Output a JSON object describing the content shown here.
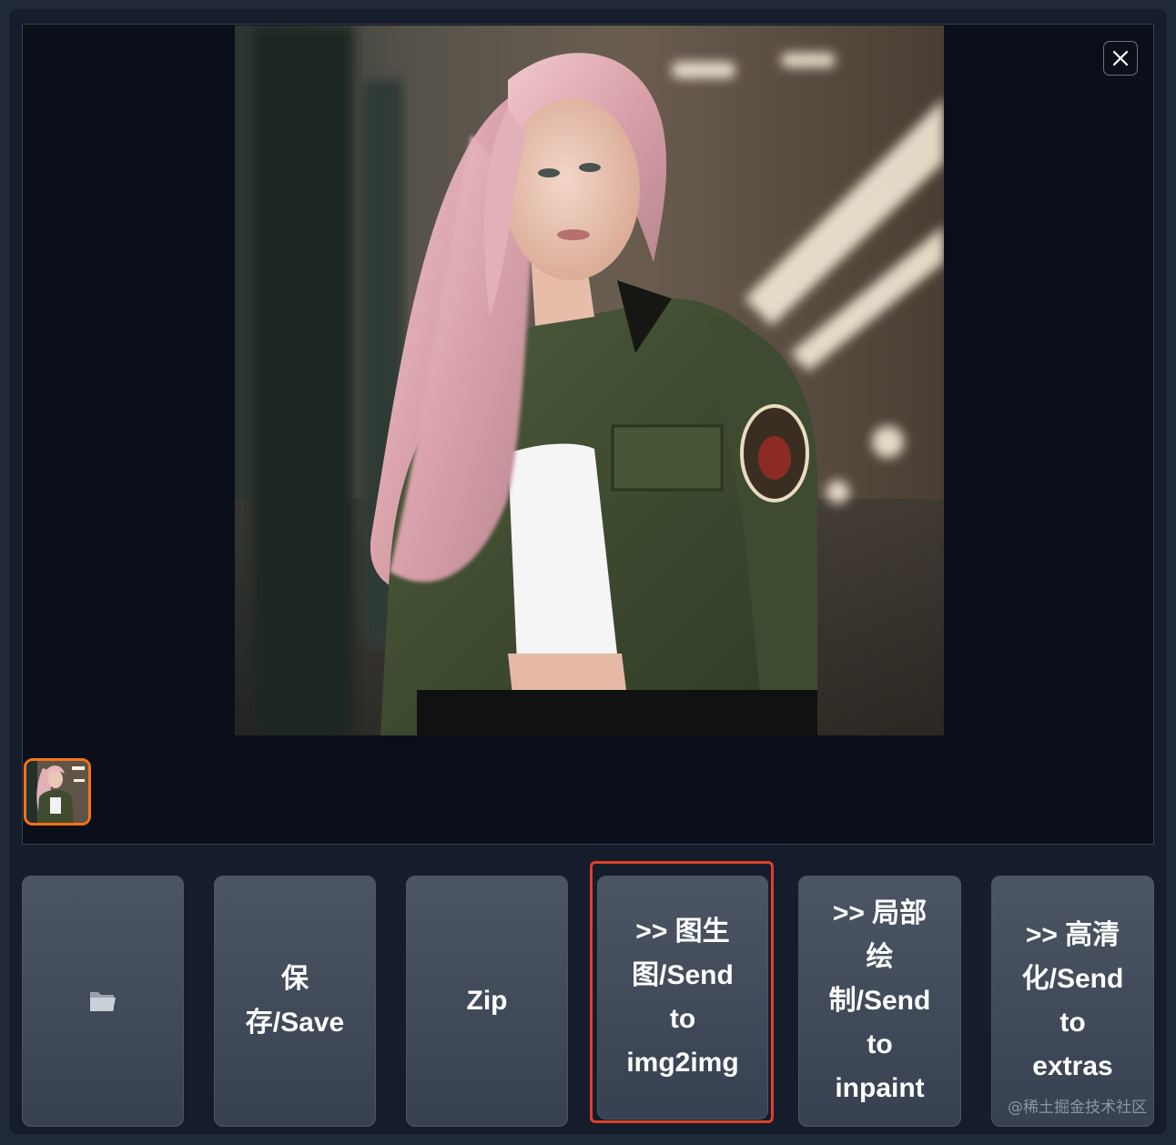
{
  "buttons": {
    "folder_icon": "folder-icon",
    "save_label": "保\n存/Save",
    "zip_label": "Zip",
    "img2img_label": ">> 图生\n图/Send\nto\nimg2img",
    "inpaint_label": ">> 局部\n绘\n制/Send\nto\ninpaint",
    "extras_label": ">> 高清\n化/Send\nto\nextras"
  },
  "gallery": {
    "close_icon": "close-icon",
    "selected_thumbnail": 1
  },
  "highlight_color": "#e0402a",
  "accent_color": "#f97316",
  "watermark": "@稀土掘金技术社区"
}
